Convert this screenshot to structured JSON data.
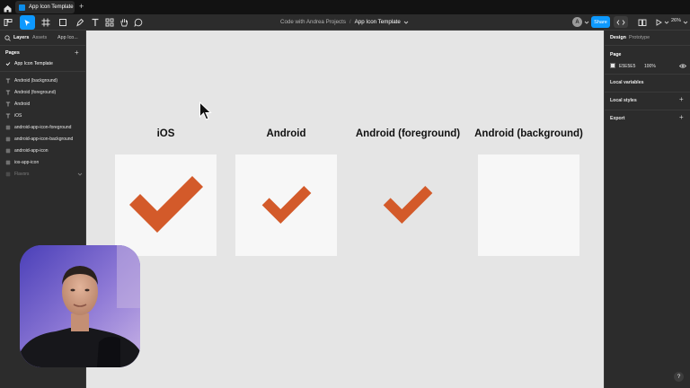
{
  "browser": {
    "tab_title": "App Icon Template",
    "new_tab": "+"
  },
  "toolbar": {
    "project": "Code with Andrea Projects",
    "separator": "/",
    "file_name": "App Icon Template",
    "avatar_initial": "A",
    "share_label": "Share",
    "zoom": "26%",
    "tools": [
      "main-menu-icon",
      "move-icon",
      "frame-icon",
      "shape-icon",
      "pen-icon",
      "text-icon",
      "resources-icon",
      "hand-icon",
      "comment-icon"
    ]
  },
  "left_panel": {
    "tabs": {
      "layers": "Layers",
      "assets": "Assets",
      "page_selector": "App Ico..."
    },
    "pages_header": "Pages",
    "pages_add": "+",
    "current_page": "App Icon Template",
    "layers": [
      {
        "label": "Android (background)",
        "icon": "text-icon"
      },
      {
        "label": "Android (foreground)",
        "icon": "text-icon"
      },
      {
        "label": "Android",
        "icon": "text-icon"
      },
      {
        "label": "iOS",
        "icon": "text-icon"
      },
      {
        "label": "android-app-icon-foreground",
        "icon": "frame-icon"
      },
      {
        "label": "android-app-icon-background",
        "icon": "frame-icon"
      },
      {
        "label": "android-app-icon",
        "icon": "frame-icon"
      },
      {
        "label": "ios-app-icon",
        "icon": "frame-icon"
      },
      {
        "label": "Flavors",
        "icon": "frame-icon"
      }
    ]
  },
  "canvas": {
    "background": "#E5E5E5",
    "accent": "#D35A2A",
    "frames": [
      {
        "title": "iOS"
      },
      {
        "title": "Android"
      },
      {
        "title": "Android (foreground)"
      },
      {
        "title": "Android (background)"
      }
    ]
  },
  "right_panel": {
    "tabs": {
      "design": "Design",
      "prototype": "Prototype"
    },
    "page_section": "Page",
    "page_color_hex": "E5E5E5",
    "page_color_opacity": "100%",
    "sections": [
      {
        "label": "Local variables"
      },
      {
        "label": "Local styles",
        "add": "+"
      },
      {
        "label": "Export",
        "add": "+"
      }
    ],
    "help": "?"
  }
}
